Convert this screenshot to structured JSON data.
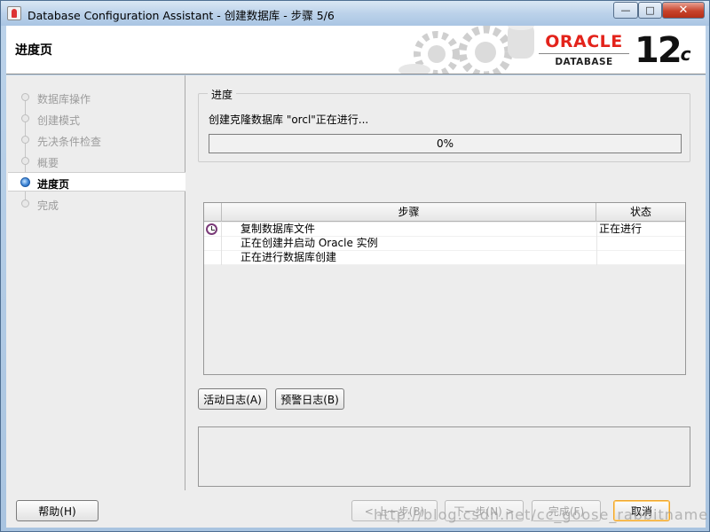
{
  "window": {
    "title": "Database Configuration Assistant - 创建数据库 - 步骤 5/6",
    "minimize_glyph": "—",
    "maximize_glyph": "□",
    "close_glyph": "✕"
  },
  "header": {
    "page_title": "进度页",
    "logo_text": "ORACLE",
    "logo_sub": "DATABASE",
    "version_number": "12",
    "version_suffix": "c"
  },
  "sidebar": {
    "steps": [
      {
        "label": "数据库操作",
        "state": "done"
      },
      {
        "label": "创建模式",
        "state": "done"
      },
      {
        "label": "先决条件检查",
        "state": "done"
      },
      {
        "label": "概要",
        "state": "done"
      },
      {
        "label": "进度页",
        "state": "active"
      },
      {
        "label": "完成",
        "state": "pending"
      }
    ]
  },
  "progress": {
    "group_label": "进度",
    "message": "创建克隆数据库 \"orcl\"正在进行...",
    "percent_text": "0%",
    "percent": 0
  },
  "steps_table": {
    "columns": [
      "步骤",
      "状态"
    ],
    "rows": [
      {
        "icon": "clock-icon",
        "step": "复制数据库文件",
        "status": "正在进行"
      },
      {
        "icon": "",
        "step": "正在创建并启动 Oracle 实例",
        "status": ""
      },
      {
        "icon": "",
        "step": "正在进行数据库创建",
        "status": ""
      }
    ]
  },
  "buttons": {
    "activity_log": "活动日志(A)",
    "alert_log": "预警日志(B)",
    "help": "帮助(H)",
    "back": "< 上一步(B)",
    "next": "下一步(N) >",
    "finish": "完成(F)",
    "cancel": "取消"
  },
  "watermark": "http://blog.csdn.net/cc_goose_rabbitname",
  "colors": {
    "accent": "#3f86d6",
    "oracle_red": "#e3231b",
    "progress_fill": "#5b8fd6"
  }
}
